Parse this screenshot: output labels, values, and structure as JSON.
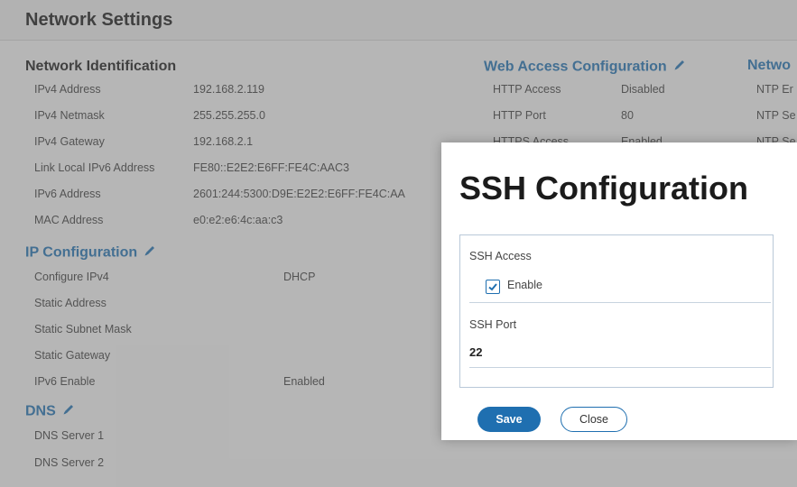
{
  "page": {
    "title": "Network Settings"
  },
  "network_identification": {
    "title": "Network Identification",
    "rows": [
      {
        "label": "IPv4 Address",
        "value": "192.168.2.119"
      },
      {
        "label": "IPv4 Netmask",
        "value": "255.255.255.0"
      },
      {
        "label": "IPv4 Gateway",
        "value": "192.168.2.1"
      },
      {
        "label": "Link Local IPv6 Address",
        "value": "FE80::E2E2:E6FF:FE4C:AAC3"
      },
      {
        "label": "IPv6 Address",
        "value": "2601:244:5300:D9E:E2E2:E6FF:FE4C:AA"
      },
      {
        "label": "MAC Address",
        "value": "e0:e2:e6:4c:aa:c3"
      }
    ]
  },
  "ip_configuration": {
    "title": "IP Configuration",
    "rows": [
      {
        "label": "Configure IPv4",
        "value": "DHCP"
      },
      {
        "label": "Static Address",
        "value": ""
      },
      {
        "label": "Static Subnet Mask",
        "value": ""
      },
      {
        "label": "Static Gateway",
        "value": ""
      },
      {
        "label": "IPv6 Enable",
        "value": "Enabled"
      }
    ]
  },
  "dns": {
    "title": "DNS",
    "rows": [
      {
        "label": "DNS Server 1",
        "value": ""
      },
      {
        "label": "DNS Server 2",
        "value": ""
      }
    ]
  },
  "web_access": {
    "title": "Web Access Configuration",
    "rows": [
      {
        "label": "HTTP Access",
        "value": "Disabled"
      },
      {
        "label": "HTTP Port",
        "value": "80"
      },
      {
        "label": "HTTPS Access",
        "value": "Enabled"
      }
    ]
  },
  "ntp": {
    "title": "Netwo",
    "rows": [
      {
        "label": "NTP Er"
      },
      {
        "label": "NTP Se"
      },
      {
        "label": "NTP Se"
      }
    ]
  },
  "modal": {
    "title": "SSH Configuration",
    "ssh_access_label": "SSH Access",
    "enable_label": "Enable",
    "enable_checked": true,
    "ssh_port_label": "SSH Port",
    "ssh_port_value": "22",
    "save_label": "Save",
    "close_label": "Close"
  },
  "colors": {
    "accent": "#1f6fb0"
  }
}
